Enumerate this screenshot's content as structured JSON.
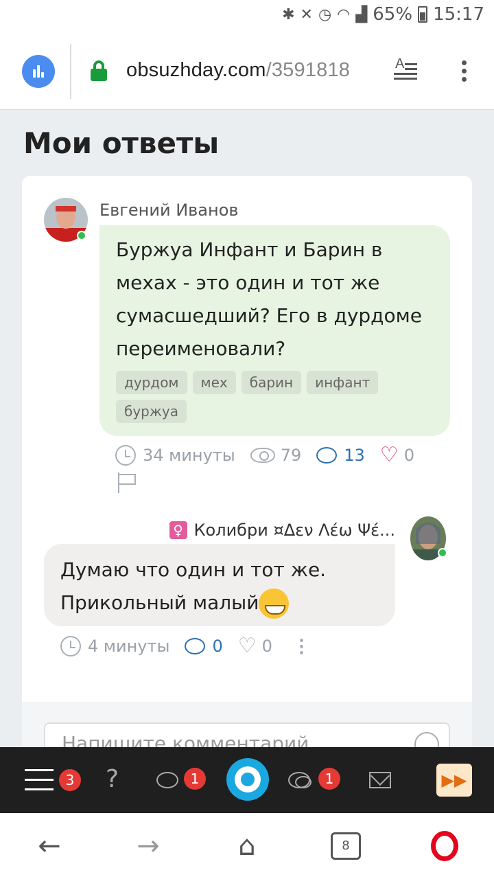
{
  "status_bar": {
    "battery": "65%",
    "time": "15:17",
    "icons": [
      "bluetooth-icon",
      "mute-icon",
      "alarm-icon",
      "wifi-icon",
      "signal-icon",
      "battery-icon"
    ]
  },
  "browser": {
    "url_domain": "obsuzhday.com",
    "url_path": "/3591818"
  },
  "page": {
    "title": "Мои ответы"
  },
  "question": {
    "author": "Евгений Иванов",
    "text": "Буржуа Инфант и Барин в мехах - это один и тот же сумасшедший? Его в дурдоме переименовали?",
    "tags": [
      "дурдом",
      "мех",
      "барин",
      "инфант",
      "буржуа"
    ],
    "time": "34 минуты",
    "views": "79",
    "comments": "13",
    "likes": "0"
  },
  "reply": {
    "author_icon": "♀",
    "author": "Колибри ¤Δεν Λέω Ψέ...",
    "text": "Думаю что один и тот же. Прикольный малый",
    "time": "4 минуты",
    "comments": "0",
    "likes": "0"
  },
  "comment_input": {
    "placeholder": "Напишите комментарий"
  },
  "bottom_nav": {
    "menu_badge": "3",
    "chat_badge": "1",
    "messages_badge": "1"
  },
  "system_nav": {
    "tabs_count": "8"
  }
}
